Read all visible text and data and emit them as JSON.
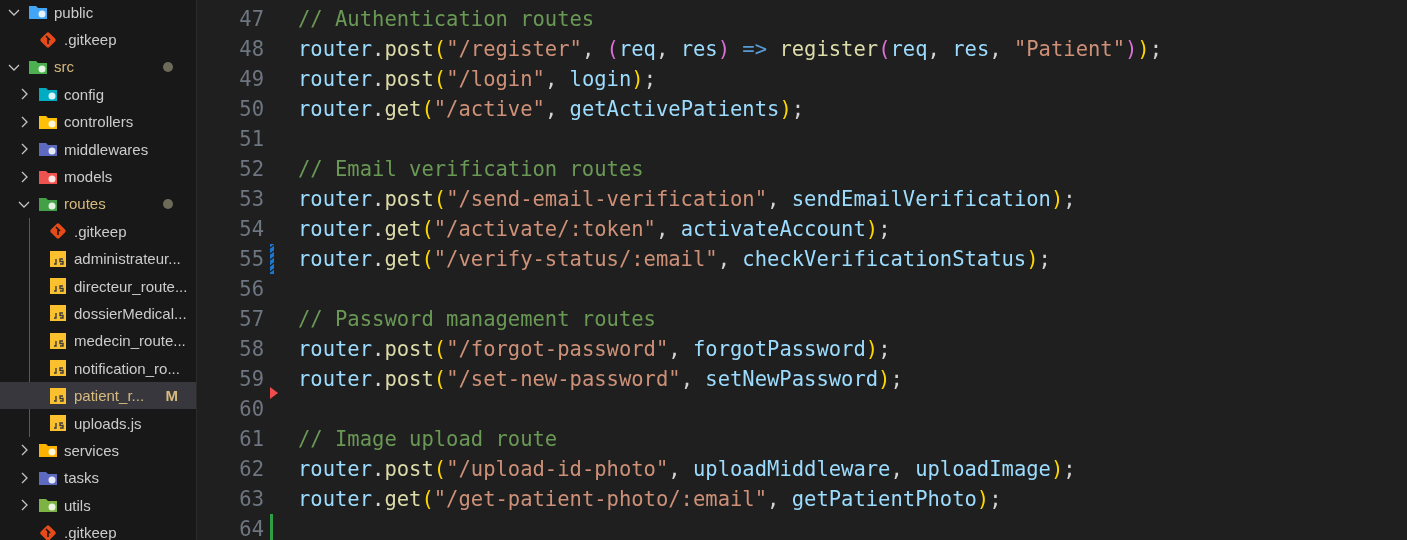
{
  "explorer": {
    "items": [
      {
        "kind": "folder",
        "label": "public",
        "color": "#42a5f5",
        "expanded": true,
        "modified": false,
        "selected": false,
        "children": [
          {
            "kind": "git",
            "label": ".gitkeep",
            "modified": false,
            "selected": false
          }
        ]
      },
      {
        "kind": "folder",
        "label": "src",
        "color": "#4caf50",
        "expanded": true,
        "modified": true,
        "selected": false,
        "children": [
          {
            "kind": "folder",
            "label": "config",
            "color": "#00acc1",
            "expanded": false,
            "modified": false,
            "selected": false
          },
          {
            "kind": "folder",
            "label": "controllers",
            "color": "#ffc107",
            "expanded": false,
            "modified": false,
            "selected": false
          },
          {
            "kind": "folder",
            "label": "middlewares",
            "color": "#5c6bc0",
            "expanded": false,
            "modified": false,
            "selected": false
          },
          {
            "kind": "folder",
            "label": "models",
            "color": "#ef5350",
            "expanded": false,
            "modified": false,
            "selected": false
          },
          {
            "kind": "folder",
            "label": "routes",
            "color": "#43a047",
            "expanded": true,
            "modified": true,
            "selected": false,
            "children": [
              {
                "kind": "git",
                "label": ".gitkeep",
                "modified": false,
                "selected": false
              },
              {
                "kind": "js",
                "label": "administrateur...",
                "modified": false,
                "selected": false
              },
              {
                "kind": "js",
                "label": "directeur_route...",
                "modified": false,
                "selected": false
              },
              {
                "kind": "js",
                "label": "dossierMedical...",
                "modified": false,
                "selected": false
              },
              {
                "kind": "js",
                "label": "medecin_route...",
                "modified": false,
                "selected": false
              },
              {
                "kind": "js",
                "label": "notification_ro...",
                "modified": false,
                "selected": false
              },
              {
                "kind": "js",
                "label": "patient_r...",
                "modified": true,
                "badge": "M",
                "selected": true
              },
              {
                "kind": "js",
                "label": "uploads.js",
                "modified": false,
                "selected": false
              }
            ]
          },
          {
            "kind": "folder",
            "label": "services",
            "color": "#ffb300",
            "expanded": false,
            "modified": false,
            "selected": false
          },
          {
            "kind": "folder",
            "label": "tasks",
            "color": "#5c6bc0",
            "expanded": false,
            "modified": false,
            "selected": false
          },
          {
            "kind": "folder",
            "label": "utils",
            "color": "#7cb342",
            "expanded": false,
            "modified": false,
            "selected": false
          },
          {
            "kind": "git",
            "label": ".gitkeep",
            "modified": false,
            "selected": false
          }
        ]
      }
    ]
  },
  "editor": {
    "lines": [
      {
        "number": "47",
        "tokens": [
          {
            "kind": "comment",
            "text": "// Authentication routes"
          }
        ]
      },
      {
        "number": "48",
        "tokens": [
          {
            "kind": "var",
            "text": "router"
          },
          {
            "kind": "punct",
            "text": "."
          },
          {
            "kind": "fn",
            "text": "post"
          },
          {
            "kind": "p1",
            "text": "("
          },
          {
            "kind": "str",
            "text": "\"/register\""
          },
          {
            "kind": "punct",
            "text": ", "
          },
          {
            "kind": "p2",
            "text": "("
          },
          {
            "kind": "var",
            "text": "req"
          },
          {
            "kind": "punct",
            "text": ", "
          },
          {
            "kind": "var",
            "text": "res"
          },
          {
            "kind": "p2",
            "text": ")"
          },
          {
            "kind": "kw",
            "text": " => "
          },
          {
            "kind": "fn",
            "text": "register"
          },
          {
            "kind": "p2",
            "text": "("
          },
          {
            "kind": "var",
            "text": "req"
          },
          {
            "kind": "punct",
            "text": ", "
          },
          {
            "kind": "var",
            "text": "res"
          },
          {
            "kind": "punct",
            "text": ", "
          },
          {
            "kind": "str",
            "text": "\"Patient\""
          },
          {
            "kind": "p2",
            "text": ")"
          },
          {
            "kind": "p1",
            "text": ")"
          },
          {
            "kind": "punct",
            "text": ";"
          }
        ]
      },
      {
        "number": "49",
        "tokens": [
          {
            "kind": "var",
            "text": "router"
          },
          {
            "kind": "punct",
            "text": "."
          },
          {
            "kind": "fn",
            "text": "post"
          },
          {
            "kind": "p1",
            "text": "("
          },
          {
            "kind": "str",
            "text": "\"/login\""
          },
          {
            "kind": "punct",
            "text": ", "
          },
          {
            "kind": "var",
            "text": "login"
          },
          {
            "kind": "p1",
            "text": ")"
          },
          {
            "kind": "punct",
            "text": ";"
          }
        ]
      },
      {
        "number": "50",
        "tokens": [
          {
            "kind": "var",
            "text": "router"
          },
          {
            "kind": "punct",
            "text": "."
          },
          {
            "kind": "fn",
            "text": "get"
          },
          {
            "kind": "p1",
            "text": "("
          },
          {
            "kind": "str",
            "text": "\"/active\""
          },
          {
            "kind": "punct",
            "text": ", "
          },
          {
            "kind": "var",
            "text": "getActivePatients"
          },
          {
            "kind": "p1",
            "text": ")"
          },
          {
            "kind": "punct",
            "text": ";"
          }
        ]
      },
      {
        "number": "51",
        "kind": "plain"
      },
      {
        "number": "52",
        "tokens": [
          {
            "kind": "comment",
            "text": "// Email verification routes"
          }
        ]
      },
      {
        "number": "53",
        "tokens": [
          {
            "kind": "var",
            "text": "router"
          },
          {
            "kind": "punct",
            "text": "."
          },
          {
            "kind": "fn",
            "text": "post"
          },
          {
            "kind": "p1",
            "text": "("
          },
          {
            "kind": "str",
            "text": "\"/send-email-verification\""
          },
          {
            "kind": "punct",
            "text": ", "
          },
          {
            "kind": "var",
            "text": "sendEmailVerification"
          },
          {
            "kind": "p1",
            "text": ")"
          },
          {
            "kind": "punct",
            "text": ";"
          }
        ]
      },
      {
        "number": "54",
        "tokens": [
          {
            "kind": "var",
            "text": "router"
          },
          {
            "kind": "punct",
            "text": "."
          },
          {
            "kind": "fn",
            "text": "get"
          },
          {
            "kind": "p1",
            "text": "("
          },
          {
            "kind": "str",
            "text": "\"/activate/:token\""
          },
          {
            "kind": "punct",
            "text": ", "
          },
          {
            "kind": "var",
            "text": "activateAccount"
          },
          {
            "kind": "p1",
            "text": ")"
          },
          {
            "kind": "punct",
            "text": ";"
          }
        ]
      },
      {
        "number": "55",
        "kind": "modified",
        "tokens": [
          {
            "kind": "var",
            "text": "router"
          },
          {
            "kind": "punct",
            "text": "."
          },
          {
            "kind": "fn",
            "text": "get"
          },
          {
            "kind": "p1",
            "text": "("
          },
          {
            "kind": "str",
            "text": "\"/verify-status/:email\""
          },
          {
            "kind": "punct",
            "text": ", "
          },
          {
            "kind": "var",
            "text": "checkVerificationStatus"
          },
          {
            "kind": "p1",
            "text": ")"
          },
          {
            "kind": "punct",
            "text": ";"
          }
        ]
      },
      {
        "number": "56",
        "kind": "plain"
      },
      {
        "number": "57",
        "tokens": [
          {
            "kind": "comment",
            "text": "// Password management routes"
          }
        ]
      },
      {
        "number": "58",
        "tokens": [
          {
            "kind": "var",
            "text": "router"
          },
          {
            "kind": "punct",
            "text": "."
          },
          {
            "kind": "fn",
            "text": "post"
          },
          {
            "kind": "p1",
            "text": "("
          },
          {
            "kind": "str",
            "text": "\"/forgot-password\""
          },
          {
            "kind": "punct",
            "text": ", "
          },
          {
            "kind": "var",
            "text": "forgotPassword"
          },
          {
            "kind": "p1",
            "text": ")"
          },
          {
            "kind": "punct",
            "text": ";"
          }
        ]
      },
      {
        "number": "59",
        "tokens": [
          {
            "kind": "var",
            "text": "router"
          },
          {
            "kind": "punct",
            "text": "."
          },
          {
            "kind": "fn",
            "text": "post"
          },
          {
            "kind": "p1",
            "text": "("
          },
          {
            "kind": "str",
            "text": "\"/set-new-password\""
          },
          {
            "kind": "punct",
            "text": ", "
          },
          {
            "kind": "var",
            "text": "setNewPassword"
          },
          {
            "kind": "p1",
            "text": ")"
          },
          {
            "kind": "punct",
            "text": ";"
          }
        ]
      },
      {
        "number": "60",
        "kind": "deleted"
      },
      {
        "number": "61",
        "tokens": [
          {
            "kind": "comment",
            "text": "// Image upload route"
          }
        ]
      },
      {
        "number": "62",
        "tokens": [
          {
            "kind": "var",
            "text": "router"
          },
          {
            "kind": "punct",
            "text": "."
          },
          {
            "kind": "fn",
            "text": "post"
          },
          {
            "kind": "p1",
            "text": "("
          },
          {
            "kind": "str",
            "text": "\"/upload-id-photo\""
          },
          {
            "kind": "punct",
            "text": ", "
          },
          {
            "kind": "var",
            "text": "uploadMiddleware"
          },
          {
            "kind": "punct",
            "text": ", "
          },
          {
            "kind": "var",
            "text": "uploadImage"
          },
          {
            "kind": "p1",
            "text": ")"
          },
          {
            "kind": "punct",
            "text": ";"
          }
        ]
      },
      {
        "number": "63",
        "tokens": [
          {
            "kind": "var",
            "text": "router"
          },
          {
            "kind": "punct",
            "text": "."
          },
          {
            "kind": "fn",
            "text": "get"
          },
          {
            "kind": "p1",
            "text": "("
          },
          {
            "kind": "str",
            "text": "\"/get-patient-photo/:email\""
          },
          {
            "kind": "punct",
            "text": ", "
          },
          {
            "kind": "var",
            "text": "getPatientPhoto"
          },
          {
            "kind": "p1",
            "text": ")"
          },
          {
            "kind": "punct",
            "text": ";"
          }
        ]
      },
      {
        "number": "64",
        "kind": "added"
      }
    ]
  }
}
